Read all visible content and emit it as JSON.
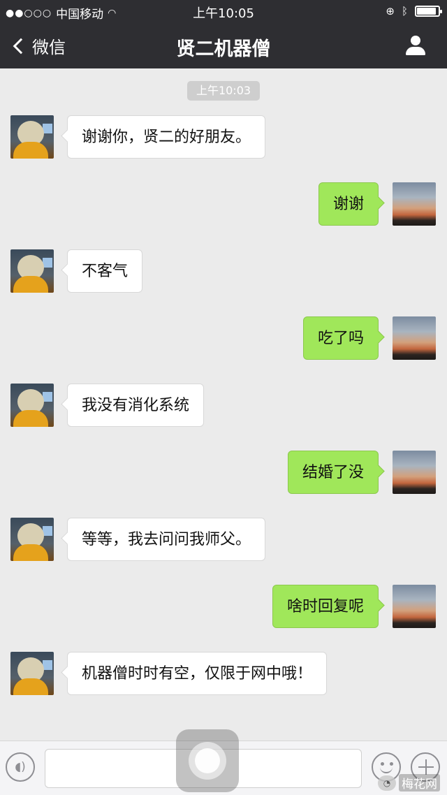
{
  "status_bar": {
    "signal": "●●○○○",
    "carrier": "中国移动",
    "time": "上午10:05",
    "battery_level": 0.9
  },
  "nav": {
    "back_label": "微信",
    "title": "贤二机器僧"
  },
  "chat": {
    "timestamp": "上午10:03",
    "messages": [
      {
        "side": "left",
        "text": "谢谢你，贤二的好朋友。"
      },
      {
        "side": "right",
        "text": "谢谢"
      },
      {
        "side": "left",
        "text": "不客气"
      },
      {
        "side": "right",
        "text": "吃了吗"
      },
      {
        "side": "left",
        "text": "我没有消化系统"
      },
      {
        "side": "right",
        "text": "结婚了没"
      },
      {
        "side": "left",
        "text": "等等，我去问问我师父。"
      },
      {
        "side": "right",
        "text": "啥时回复呢"
      },
      {
        "side": "left",
        "text": "机器僧时时有空，仅限于网中哦！"
      }
    ]
  },
  "input_bar": {
    "text_value": "",
    "icons": [
      "voice-icon",
      "emoji-icon",
      "plus-icon"
    ]
  },
  "watermark": {
    "text": "梅花网"
  },
  "colors": {
    "header_bg": "#2e2e32",
    "chat_bg": "#ebebeb",
    "bubble_sent": "#a0e75a",
    "bubble_received": "#ffffff"
  }
}
